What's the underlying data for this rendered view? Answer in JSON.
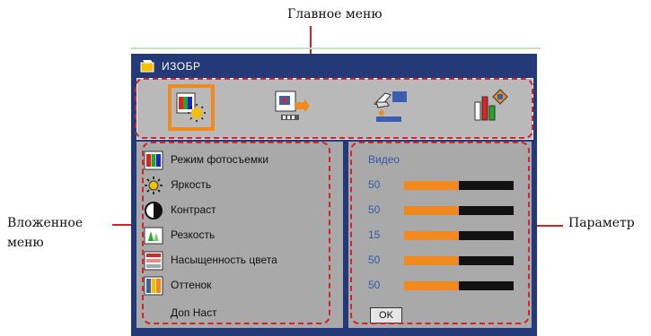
{
  "callouts": {
    "main_menu": "Главное меню",
    "submenu": "Вложенное\nменю",
    "parameter": "Параметр"
  },
  "window": {
    "title": "ИЗОБР",
    "title_icon": "picture-icon"
  },
  "main_menu_icons": [
    {
      "name": "image-menu-icon",
      "selected": true
    },
    {
      "name": "display-menu-icon",
      "selected": false
    },
    {
      "name": "settings-menu-icon",
      "selected": false
    },
    {
      "name": "options-menu-icon",
      "selected": false
    }
  ],
  "submenu": [
    {
      "label": "Режим фотосъемки",
      "icon": "color-mode-icon"
    },
    {
      "label": "Яркость",
      "icon": "brightness-icon"
    },
    {
      "label": "Контраст",
      "icon": "contrast-icon"
    },
    {
      "label": "Резкость",
      "icon": "sharpness-icon"
    },
    {
      "label": "Насыщенность цвета",
      "icon": "saturation-icon"
    },
    {
      "label": "Оттенок",
      "icon": "tint-icon"
    },
    {
      "label": "Доп Наст",
      "icon": ""
    }
  ],
  "parameters": {
    "mode_value": "Видео",
    "rows": [
      {
        "value": "50",
        "level": 0.5
      },
      {
        "value": "50",
        "level": 0.5
      },
      {
        "value": "15",
        "level": 0.5
      },
      {
        "value": "50",
        "level": 0.5
      },
      {
        "value": "50",
        "level": 0.5
      }
    ],
    "ok_label": "OK"
  },
  "colors": {
    "osd_background": "#243a78",
    "panel_gray": "#a9a9a9",
    "accent_orange": "#f08a1f",
    "callout_red": "#d3232a",
    "value_blue": "#3459a8"
  }
}
